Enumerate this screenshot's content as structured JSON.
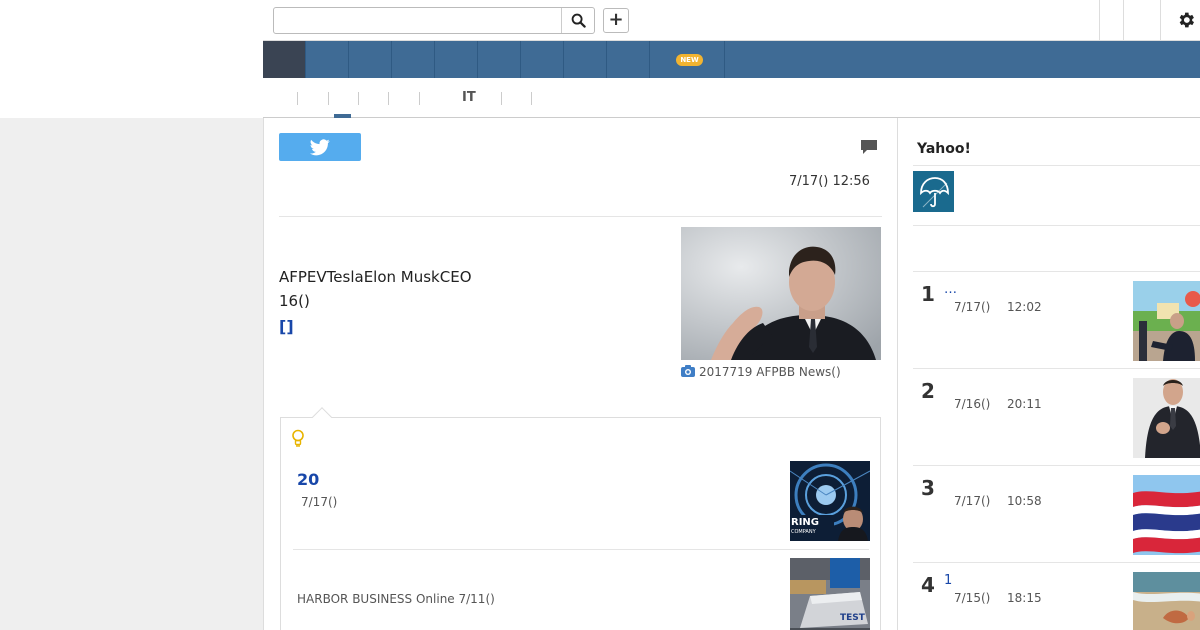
{
  "search": {
    "placeholder": ""
  },
  "header": {
    "plus_label": "+"
  },
  "nav": {
    "new_badge": "NEW"
  },
  "subnav": {
    "active_label": "IT"
  },
  "article": {
    "datetime": "7/17() 12:56",
    "body_line1": "AFPEVTeslaElon MuskCEO",
    "body_line2": "16()",
    "link_label": "[]",
    "photo_caption": "2017719 AFPBB News()"
  },
  "related": {
    "items": [
      {
        "title": "20",
        "meta": "7/17()"
      },
      {
        "title": "",
        "meta": "HARBOR BUSINESS Online 7/11()"
      }
    ]
  },
  "sidebar": {
    "title": "Yahoo!",
    "ranking": [
      {
        "rank": "1",
        "title": "…",
        "date": "7/17()",
        "time": "12:02"
      },
      {
        "rank": "2",
        "title": "",
        "date": "7/16()",
        "time": "20:11"
      },
      {
        "rank": "3",
        "title": "",
        "date": "7/17()",
        "time": "10:58"
      },
      {
        "rank": "4",
        "title": "1",
        "date": "7/15()",
        "time": "18:15"
      }
    ]
  },
  "colors": {
    "nav_bar": "#3f6b95",
    "nav_active": "#3a4453",
    "link_blue": "#1847a9",
    "twitter": "#55acee",
    "new_badge": "#f2b431"
  },
  "icons": [
    "search-icon",
    "plus-icon",
    "gear-icon",
    "twitter-icon",
    "comment-icon",
    "camera-icon",
    "bulb-icon",
    "umbrella-icon"
  ]
}
